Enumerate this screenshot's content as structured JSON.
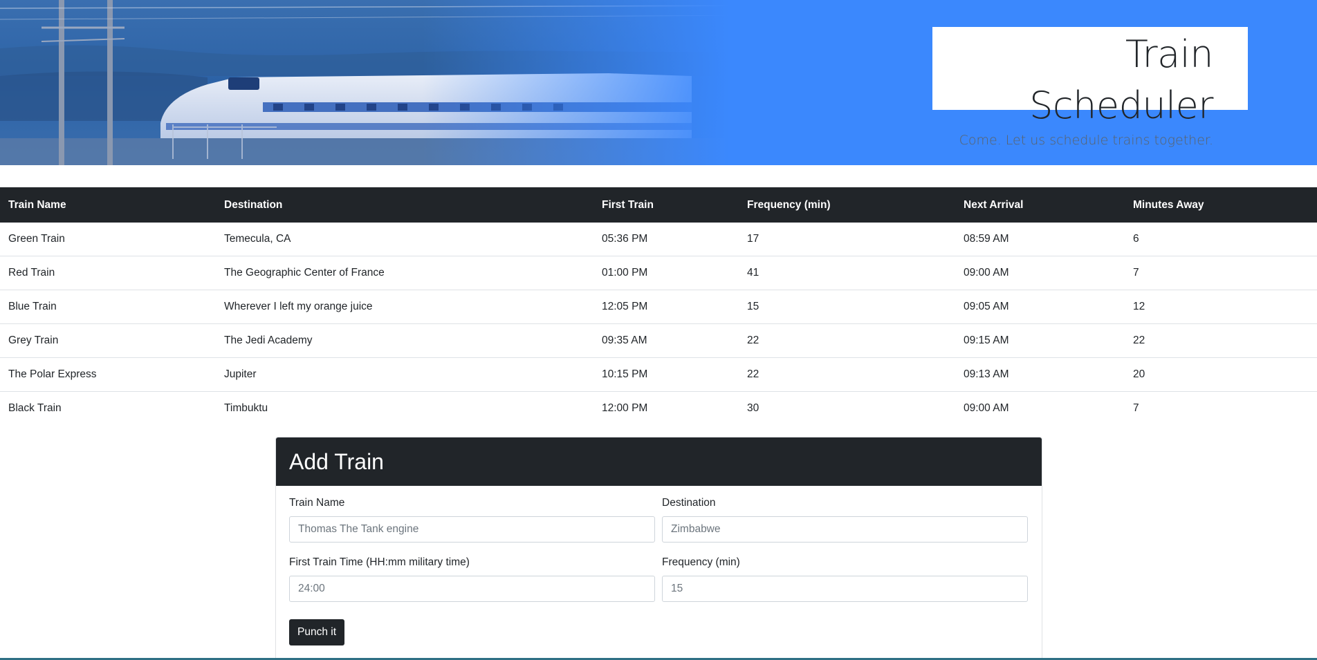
{
  "header": {
    "title": "Train Scheduler",
    "subtitle": "Come. Let us schedule trains together.",
    "background_color": "#3b88fd"
  },
  "schedule": {
    "columns": [
      "Train Name",
      "Destination",
      "First Train",
      "Frequency (min)",
      "Next Arrival",
      "Minutes Away"
    ],
    "rows": [
      [
        "Green Train",
        "Temecula, CA",
        "05:36 PM",
        "17",
        "08:59 AM",
        "6"
      ],
      [
        "Red Train",
        "The Geographic Center of France",
        "01:00 PM",
        "41",
        "09:00 AM",
        "7"
      ],
      [
        "Blue Train",
        "Wherever I left my orange juice",
        "12:05 PM",
        "15",
        "09:05 AM",
        "12"
      ],
      [
        "Grey Train",
        "The Jedi Academy",
        "09:35 AM",
        "22",
        "09:15 AM",
        "22"
      ],
      [
        "The Polar Express",
        "Jupiter",
        "10:15 PM",
        "22",
        "09:13 AM",
        "20"
      ],
      [
        "Black Train",
        "Timbuktu",
        "12:00 PM",
        "30",
        "09:00 AM",
        "7"
      ]
    ]
  },
  "form": {
    "title": "Add Train",
    "train_name": {
      "label": "Train Name",
      "placeholder": "Thomas The Tank engine"
    },
    "destination": {
      "label": "Destination",
      "placeholder": "Zimbabwe"
    },
    "first_train": {
      "label": "First Train Time (HH:mm military time)",
      "placeholder": "24:00"
    },
    "frequency": {
      "label": "Frequency (min)",
      "placeholder": "15"
    },
    "submit_label": "Punch it"
  },
  "colors": {
    "dark": "#212529",
    "hero_blue": "#3b88fd"
  }
}
